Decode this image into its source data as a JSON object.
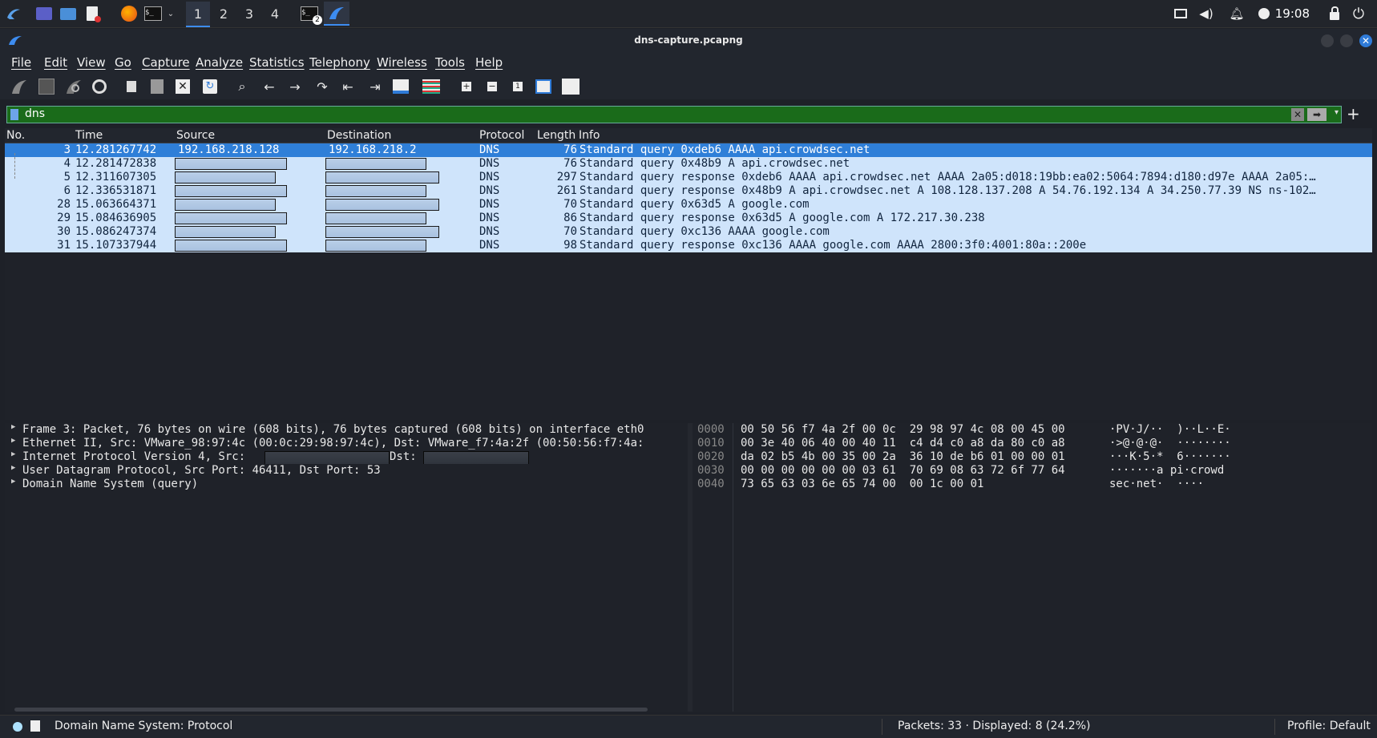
{
  "taskbar": {
    "workspaces": [
      "1",
      "2",
      "3",
      "4"
    ],
    "active_workspace": "1",
    "terminal_badge": "2",
    "clock": "19:08"
  },
  "window": {
    "title": "dns-capture.pcapng"
  },
  "menu": [
    "File",
    "Edit",
    "View",
    "Go",
    "Capture",
    "Analyze",
    "Statistics",
    "Telephony",
    "Wireless",
    "Tools",
    "Help"
  ],
  "filter": {
    "value": "dns",
    "accent": "#1a6b1a"
  },
  "columns": [
    "No.",
    "Time",
    "Source",
    "Destination",
    "Protocol",
    "Length",
    "Info"
  ],
  "packets": [
    {
      "no": "3",
      "time": "12.281267742",
      "src": "192.168.218.128",
      "dst": "192.168.218.2",
      "proto": "DNS",
      "len": "76",
      "info": "Standard query 0xdeb6 AAAA api.crowdsec.net",
      "selected": true
    },
    {
      "no": "4",
      "time": "12.281472838",
      "src": "",
      "dst": "",
      "proto": "DNS",
      "len": "76",
      "info": "Standard query 0x48b9 A api.crowdsec.net"
    },
    {
      "no": "5",
      "time": "12.311607305",
      "src": "",
      "dst": "",
      "proto": "DNS",
      "len": "297",
      "info": "Standard query response 0xdeb6 AAAA api.crowdsec.net AAAA 2a05:d018:19bb:ea02:5064:7894:d180:d97e AAAA 2a05:…"
    },
    {
      "no": "6",
      "time": "12.336531871",
      "src": "",
      "dst": "",
      "proto": "DNS",
      "len": "261",
      "info": "Standard query response 0x48b9 A api.crowdsec.net A 108.128.137.208 A 54.76.192.134 A 34.250.77.39 NS ns-102…"
    },
    {
      "no": "28",
      "time": "15.063664371",
      "src": "",
      "dst": "",
      "proto": "DNS",
      "len": "70",
      "info": "Standard query 0x63d5 A google.com"
    },
    {
      "no": "29",
      "time": "15.084636905",
      "src": "",
      "dst": "",
      "proto": "DNS",
      "len": "86",
      "info": "Standard query response 0x63d5 A google.com A 172.217.30.238"
    },
    {
      "no": "30",
      "time": "15.086247374",
      "src": "",
      "dst": "",
      "proto": "DNS",
      "len": "70",
      "info": "Standard query 0xc136 AAAA google.com"
    },
    {
      "no": "31",
      "time": "15.107337944",
      "src": "",
      "dst": "",
      "proto": "DNS",
      "len": "98",
      "info": "Standard query response 0xc136 AAAA google.com AAAA 2800:3f0:4001:80a::200e"
    }
  ],
  "details": [
    "Frame 3: Packet, 76 bytes on wire (608 bits), 76 bytes captured (608 bits) on interface eth0",
    "Ethernet II, Src: VMware_98:97:4c (00:0c:29:98:97:4c), Dst: VMware_f7:4a:2f (00:50:56:f7:4a:",
    "Internet Protocol Version 4, Src:",
    "User Datagram Protocol, Src Port: 46411, Dst Port: 53",
    "Domain Name System (query)"
  ],
  "details_dst_label": "Dst:",
  "hex": [
    {
      "offset": "0000",
      "bytes": "00 50 56 f7 4a 2f 00 0c  29 98 97 4c 08 00 45 00",
      "ascii": "·PV·J/··  )··L··E·"
    },
    {
      "offset": "0010",
      "bytes": "00 3e 40 06 40 00 40 11  c4 d4 c0 a8 da 80 c0 a8",
      "ascii": "·>@·@·@·  ········"
    },
    {
      "offset": "0020",
      "bytes": "da 02 b5 4b 00 35 00 2a  36 10 de b6 01 00 00 01",
      "ascii": "···K·5·*  6·······"
    },
    {
      "offset": "0030",
      "bytes": "00 00 00 00 00 00 03 61  70 69 08 63 72 6f 77 64",
      "ascii": "·······a pi·crowd"
    },
    {
      "offset": "0040",
      "bytes": "73 65 63 03 6e 65 74 00  00 1c 00 01",
      "ascii": "sec·net·  ····"
    }
  ],
  "status": {
    "left": "Domain Name System: Protocol",
    "packets": "Packets: 33 · Displayed: 8 (24.2%)",
    "profile": "Profile: Default"
  }
}
